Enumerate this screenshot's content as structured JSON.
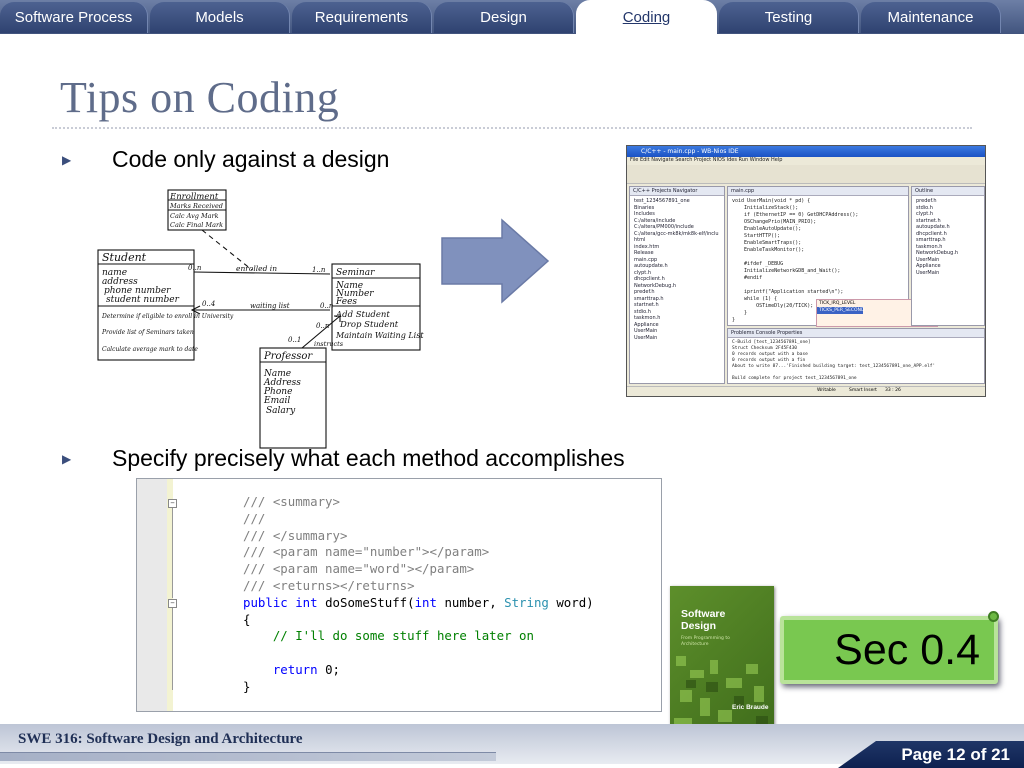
{
  "nav": {
    "tabs": [
      {
        "label": "Software Process",
        "active": false
      },
      {
        "label": "Models",
        "active": false
      },
      {
        "label": "Requirements",
        "active": false
      },
      {
        "label": "Design",
        "active": false
      },
      {
        "label": "Coding",
        "active": true
      },
      {
        "label": "Testing",
        "active": false
      },
      {
        "label": "Maintenance",
        "active": false
      }
    ]
  },
  "slide": {
    "title": "Tips on Coding",
    "bullets": [
      "Code only against a design",
      "Specify precisely what each method accomplishes"
    ]
  },
  "uml_sketch": {
    "enrollment": {
      "name": "Enrollment",
      "attrs": [
        "Marks Received"
      ],
      "methods": [
        "Calc Avg Mark",
        "Calc Final Mark"
      ]
    },
    "student": {
      "name": "Student",
      "attrs": [
        "name",
        "address",
        "phone number",
        "student number"
      ],
      "methods": [
        "Determine if eligible to enroll in University",
        "Provide list of Seminars taken",
        "Calculate average mark to date"
      ]
    },
    "seminar": {
      "name": "Seminar",
      "attrs": [
        "Name",
        "Number",
        "Fees"
      ],
      "methods": [
        "Add Student",
        "Drop Student",
        "Maintain Waiting List"
      ]
    },
    "professor": {
      "name": "Professor",
      "attrs": [
        "Name",
        "Address",
        "Phone",
        "Email",
        "Salary"
      ]
    },
    "labels": {
      "enrolled_in": "enrolled in",
      "waiting_list": "waiting list",
      "instructs": "instructs",
      "mult_0n": "0..n",
      "mult_1n": "1..n",
      "mult_04": "0..4",
      "mult_0n_b": "0..n",
      "mult_01": "0..1",
      "mult_0n_c": "0..n"
    }
  },
  "ide": {
    "title": "C/C++ - main.cpp - WB-Nios IDE",
    "menu": "File  Edit  Navigate  Search  Project  NIOS Ides  Run  Window  Help",
    "left_tabs": "C/C++ Projects  Navigator",
    "tree": [
      "test_1234567891_one",
      "Binaries",
      "Includes",
      "C:/altera/include",
      "C:/altera/PM000/include",
      "C:/altera/gcc-mk8k/mk8k-elf/inclu",
      "html",
      "index.htm",
      "Release",
      "main.cpp",
      "autoupdate.h",
      "clypt.h",
      "dhcpclient.h",
      "NetworkDebug.h",
      "predef.h",
      "smarttrap.h",
      "startnet.h",
      "stdio.h",
      "taskmon.h",
      "Appliance",
      "UserMain",
      "UserMain"
    ],
    "editor_tab": "main.cpp",
    "code": [
      "void UserMain(void * pd) {",
      "    InitializeStack();",
      "    if (EthernetIP == 0) GetDHCPAddress();",
      "    OSChangePrio(MAIN_PRIO);",
      "    EnableAutoUpdate();",
      "    StartHTTP();",
      "    EnableSmartTraps();",
      "    EnableTaskMonitor();",
      "",
      "    #ifdef _DEBUG",
      "    InitializeNetworkGDB_and_Wait();",
      "    #endif",
      "",
      "    iprintf(\"Application started\\n\");",
      "    while (1) {",
      "        OSTimeDly(20/TICK);",
      "    }",
      "}"
    ],
    "autocomplete": [
      "TICK_IRQ_LEVEL",
      "TICKS_PER_SECOND"
    ],
    "outline_tab": "Outline",
    "outline": [
      "predef.h",
      "stdio.h",
      "clypt.h",
      "startnet.h",
      "autoupdate.h",
      "dhcpclient.h",
      "smarttrap.h",
      "taskmon.h",
      "NetworkDebug.h",
      "UserMain",
      "Appliance",
      "UserMain"
    ],
    "console_tabs": "Problems  Console  Properties",
    "console": [
      "C-Build [test_1234567891_one]",
      "Struct Checksum 2F45F430",
      "0 records output with a base",
      "0 records output with a fin",
      "About to write 87...'Finished building target: test_1234567891_one_APP.elf'",
      "",
      "Build complete for project test_1234567891_one"
    ],
    "status": [
      "Writable",
      "Smart Insert",
      "33 : 26"
    ]
  },
  "code_sample": {
    "lines": [
      [
        {
          "t": "/// ",
          "c": "comment"
        },
        {
          "t": "<summary>",
          "c": "comment"
        }
      ],
      [
        {
          "t": "///",
          "c": "comment"
        }
      ],
      [
        {
          "t": "/// ",
          "c": "comment"
        },
        {
          "t": "</summary>",
          "c": "comment"
        }
      ],
      [
        {
          "t": "/// ",
          "c": "comment"
        },
        {
          "t": "<param name=\"number\"></param>",
          "c": "comment"
        }
      ],
      [
        {
          "t": "/// ",
          "c": "comment"
        },
        {
          "t": "<param name=\"word\"></param>",
          "c": "comment"
        }
      ],
      [
        {
          "t": "/// ",
          "c": "comment"
        },
        {
          "t": "<returns></returns>",
          "c": "comment"
        }
      ],
      [
        {
          "t": "public ",
          "c": "kw"
        },
        {
          "t": "int ",
          "c": "kw"
        },
        {
          "t": "doSomeStuff(",
          "c": "plain"
        },
        {
          "t": "int ",
          "c": "kw"
        },
        {
          "t": "number, ",
          "c": "plain"
        },
        {
          "t": "String ",
          "c": "type"
        },
        {
          "t": "word)",
          "c": "plain"
        }
      ],
      [
        {
          "t": "{",
          "c": "plain"
        }
      ],
      [
        {
          "t": "    // I'll do some stuff here later on",
          "c": "green"
        }
      ],
      [
        {
          "t": "",
          "c": "plain"
        }
      ],
      [
        {
          "t": "    ",
          "c": "plain"
        },
        {
          "t": "return ",
          "c": "kw"
        },
        {
          "t": "0;",
          "c": "plain"
        }
      ],
      [
        {
          "t": "}",
          "c": "plain"
        }
      ]
    ]
  },
  "book": {
    "title_line1": "Software",
    "title_line2": "Design",
    "subtitle": "From Programming to Architecture",
    "author": "Eric Braude"
  },
  "section_badge": "Sec 0.4",
  "footer": {
    "course": "SWE 316: Software Design and Architecture",
    "page": "Page 12 of 21"
  },
  "colors": {
    "tab_bg": "#2f4270",
    "tab_active_text": "#23366a",
    "title": "#5f6c8a",
    "arrow_fill": "#8091bd",
    "badge_green": "#79c850",
    "book_green": "#4f7d24",
    "footer_navy": "#14295a"
  }
}
